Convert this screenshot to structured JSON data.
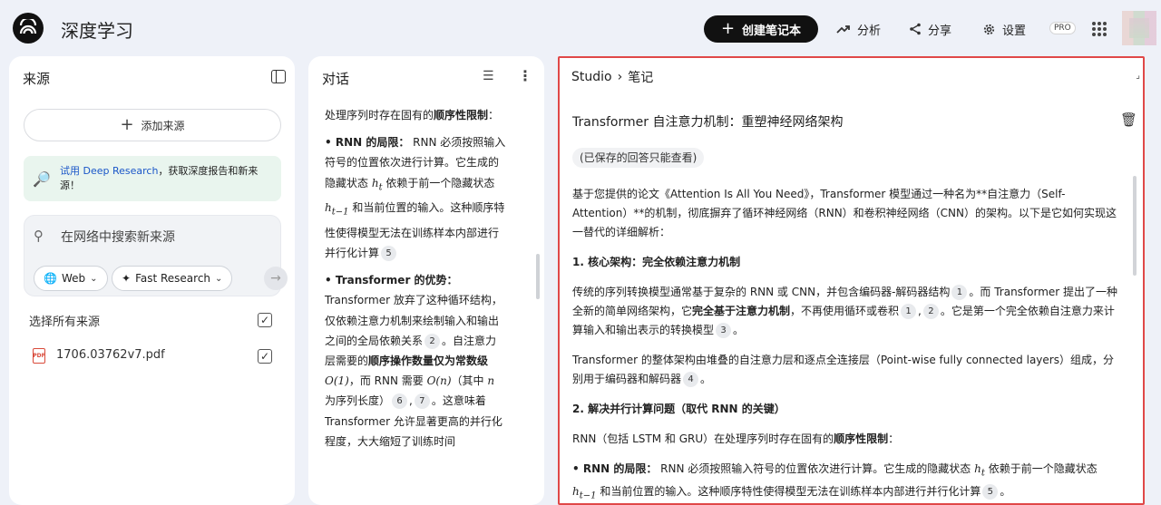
{
  "app": {
    "title": "深度学习"
  },
  "header": {
    "create_label": "创建笔记本",
    "analytics_label": "分析",
    "share_label": "分享",
    "settings_label": "设置",
    "pro_badge": "PRO"
  },
  "sources": {
    "title": "来源",
    "add_label": "添加来源",
    "deep_research_link": "试用 Deep Research",
    "deep_research_text": "，获取深度报告和新来源！",
    "search_placeholder": "在网络中搜索新来源",
    "web_label": "Web",
    "fast_research_label": "Fast Research",
    "select_all_label": "选择所有来源",
    "pdf_label": "PDF",
    "files": [
      {
        "name": "1706.03762v7.pdf"
      }
    ]
  },
  "chat": {
    "title": "对话",
    "t1": "处理序列时存在固有的",
    "t1b": "顺序性限制",
    "t1c": "：",
    "rnn_head": "• RNN 的局限：",
    "rnn_a": " RNN 必须按照输入符号的位置依次进行计算。它生成的隐藏状态 ",
    "rnn_ht": "h",
    "rnn_ht_sub": "t",
    "rnn_b": " 依赖于前一个隐藏状态 ",
    "rnn_ht1_sub": "t−1",
    "rnn_c": " 和当前位置的输入。这种顺序特性使得模型无法在训练样本内部进行并行化计算",
    "cite5": "5",
    "tf_head": "• Transformer 的优势：",
    "tf_a": "Transformer 放弃了这种循环结构，仅依赖注意力机制来绘制输入和输出之间的全局依赖关系",
    "cite2": "2",
    "tf_b": "。自注意力层需要的",
    "tf_bold": "顺序操作数量仅为常数级",
    "tf_o1": "O(1)",
    "tf_c": "，而 RNN 需要 ",
    "tf_on": "O(n)",
    "tf_d": "（其中 ",
    "tf_n": "n",
    "tf_e": " 为序列长度）",
    "cite6": "6",
    "cite7": "7",
    "tf_f": "。这意味着 Transformer 允许显著更高的并行化程度，大大缩短了训练时间"
  },
  "studio": {
    "crumb_root": "Studio",
    "crumb_sep": "›",
    "crumb_leaf": "笔记",
    "note_title": "Transformer 自注意力机制：重塑神经网络架构",
    "saved_chip": "(已保存的回答只能查看)",
    "p1": "基于您提供的论文《Attention Is All You Need》，Transformer 模型通过一种名为**自注意力（Self-Attention）**的机制，彻底摒弃了循环神经网络（RNN）和卷积神经网络（CNN）的架构。以下是它如何实现这一替代的详细解析：",
    "h1": "1. 核心架构：完全依赖注意力机制",
    "p2a": "传统的序列转换模型通常基于复杂的 RNN 或 CNN，并包含编码器-解码器结构",
    "c1": "1",
    "p2b": "。而 Transformer 提出了一种全新的简单网络架构，它",
    "p2bold": "完全基于注意力机制",
    "p2c": "，不再使用循环或卷积",
    "c1b": "1",
    "c2": "2",
    "p2d": "。它是第一个完全依赖自注意力来计算输入和输出表示的转换模型",
    "c3": "3",
    "p2e": "。",
    "p3a": "Transformer 的整体架构由堆叠的自注意力层和逐点全连接层（Point-wise fully connected layers）组成，分别用于编码器和解码器",
    "c4": "4",
    "p3b": "。",
    "h2": "2. 解决并行计算问题（取代 RNN 的关键）",
    "p4a": "RNN（包括 LSTM 和 GRU）在处理序列时存在固有的",
    "p4bold": "顺序性限制",
    "p4b": "：",
    "p5head": "• RNN 的局限：",
    "p5a": " RNN 必须按照输入符号的位置依次进行计算。它生成的隐藏状态 ",
    "p5h": "h",
    "p5t": "t",
    "p5b": " 依赖于前一个隐藏状态 ",
    "p5t1": "t−1",
    "p5c": " 和当前位置的输入。这种顺序特性使得模型无法在训练样本内部进行并行化计算",
    "c5": "5",
    "p5d": "。"
  }
}
